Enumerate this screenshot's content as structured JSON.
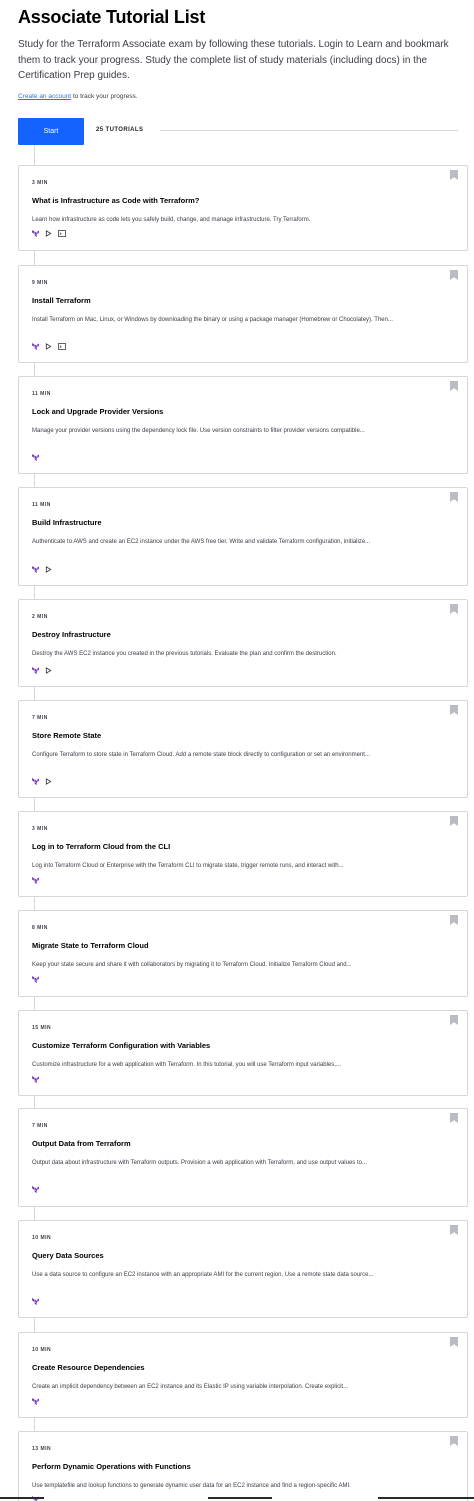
{
  "header": {
    "title": "Associate Tutorial List",
    "intro": "Study for the Terraform Associate exam by following these tutorials. Login to Learn and bookmark them to track your progress. Study the complete list of study materials (including docs) in the Certification Prep guides.",
    "create_link": "Create an account",
    "create_suffix": "to track your progress."
  },
  "toolbar": {
    "start_label": "Start",
    "count_label": "25 TUTORIALS"
  },
  "colors": {
    "accent": "#1563ff",
    "terraform_purple": "#7b42bc",
    "border": "#d5d7db"
  },
  "tutorials": [
    {
      "duration": "3 MIN",
      "title": "What is Infrastructure as Code with Terraform?",
      "desc": "Learn how infrastructure as code lets you safely build, change, and manage infrastructure. Try Terraform.",
      "icons": [
        "terraform-icon",
        "play-icon",
        "terminal-icon"
      ]
    },
    {
      "duration": "9 MIN",
      "title": "Install Terraform",
      "desc": "Install Terraform on Mac, Linux, or Windows by downloading the binary or using a package manager (Homebrew or Chocolatey). Then...",
      "icons": [
        "terraform-icon",
        "play-icon",
        "terminal-icon"
      ]
    },
    {
      "duration": "11 MIN",
      "title": "Lock and Upgrade Provider Versions",
      "desc": "Manage your provider versions using the dependency lock file. Use version constraints to filter provider versions compatible...",
      "icons": [
        "terraform-icon"
      ]
    },
    {
      "duration": "11 MIN",
      "title": "Build Infrastructure",
      "desc": "Authenticate to AWS and create an EC2 instance under the AWS free tier. Write and validate Terraform configuration, initialize...",
      "icons": [
        "terraform-icon",
        "play-icon"
      ]
    },
    {
      "duration": "2 MIN",
      "title": "Destroy Infrastructure",
      "desc": "Destroy the AWS EC2 instance you created in the previous tutorials. Evaluate the plan and confirm the destruction.",
      "icons": [
        "terraform-icon",
        "play-icon"
      ]
    },
    {
      "duration": "7 MIN",
      "title": "Store Remote State",
      "desc": "Configure Terraform to store state in Terraform Cloud. Add a remote state block directly to configuration or set an environment...",
      "icons": [
        "terraform-icon",
        "play-icon"
      ]
    },
    {
      "duration": "3 MIN",
      "title": "Log in to Terraform Cloud from the CLI",
      "desc": "Log into Terraform Cloud or Enterprise with the Terraform CLI to migrate state, trigger remote runs, and interact with...",
      "icons": [
        "terraform-icon"
      ]
    },
    {
      "duration": "8 MIN",
      "title": "Migrate State to Terraform Cloud",
      "desc": "Keep your state secure and share it with collaborators by migrating it to Terraform Cloud. Initialize Terraform Cloud and...",
      "icons": [
        "terraform-icon"
      ]
    },
    {
      "duration": "15 MIN",
      "title": "Customize Terraform Configuration with Variables",
      "desc": "Customize infrastructure for a web application with Terraform. In this tutorial, you will use Terraform input variables,...",
      "icons": [
        "terraform-icon"
      ]
    },
    {
      "duration": "7 MIN",
      "title": "Output Data from Terraform",
      "desc": "Output data about infrastructure with Terraform outputs. Provision a web application with Terraform, and use output values to...",
      "icons": [
        "terraform-icon"
      ]
    },
    {
      "duration": "10 MIN",
      "title": "Query Data Sources",
      "desc": "Use a data source to configure an EC2 instance with an appropriate AMI for the current region. Use a remote state data source...",
      "icons": [
        "terraform-icon"
      ]
    },
    {
      "duration": "10 MIN",
      "title": "Create Resource Dependencies",
      "desc": "Create an implicit dependency between an EC2 instance and its Elastic IP using variable interpolation. Create explicit...",
      "icons": [
        "terraform-icon"
      ]
    },
    {
      "duration": "13 MIN",
      "title": "Perform Dynamic Operations with Functions",
      "desc": "Use templatefile and lookup functions to generate dynamic user data for an EC2 instance and find a region-specific AMI.",
      "icons": [
        "terraform-icon"
      ]
    }
  ]
}
